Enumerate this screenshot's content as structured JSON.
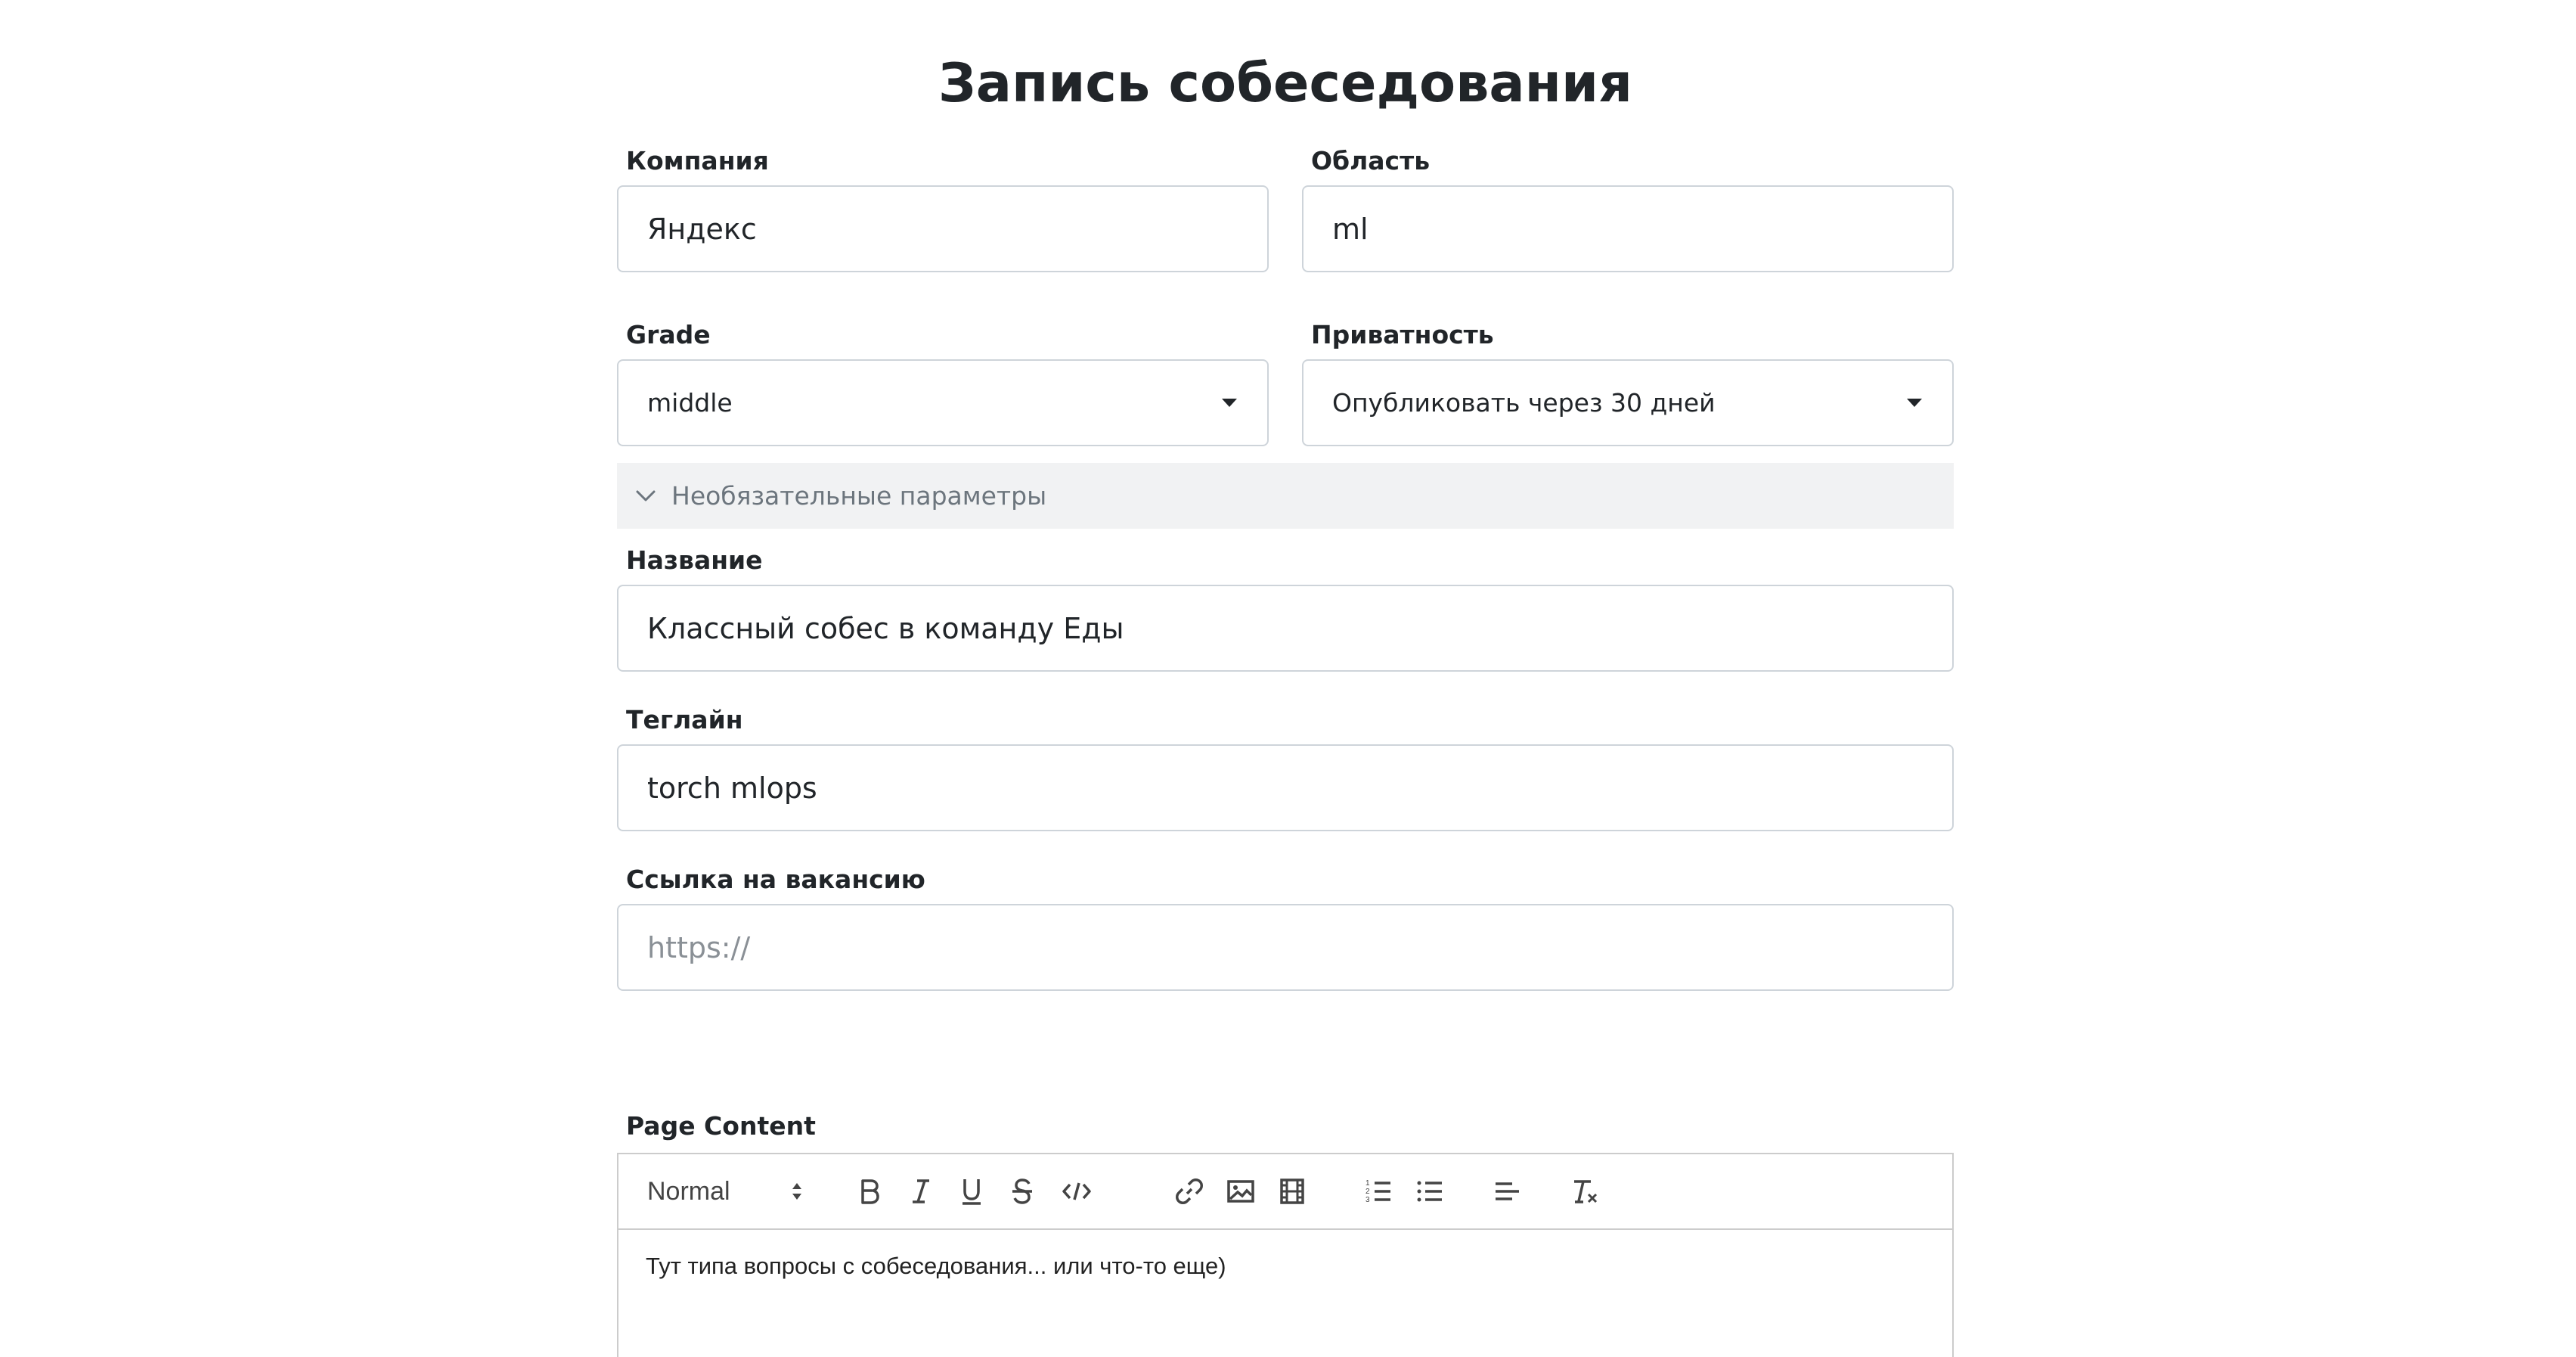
{
  "title": "Запись собеседования",
  "company": {
    "label": "Компания",
    "value": "Яндекс"
  },
  "area": {
    "label": "Область",
    "value": "ml"
  },
  "grade": {
    "label": "Grade",
    "value": "middle"
  },
  "privacy": {
    "label": "Приватность",
    "value": "Опубликовать через 30 дней"
  },
  "optional_section": {
    "label": "Необязательные параметры",
    "expanded": true
  },
  "name": {
    "label": "Название",
    "value": "Классный собес в команду Еды"
  },
  "tagline": {
    "label": "Теглайн",
    "value": "torch mlops"
  },
  "vacancy_link": {
    "label": "Ссылка на вакансию",
    "value": "",
    "placeholder": "https://"
  },
  "content": {
    "label": "Page Content",
    "format": "Normal",
    "text": "Тут типа вопросы с собеседования... или что-то еще)",
    "toolbar_icons": [
      "bold-icon",
      "italic-icon",
      "underline-icon",
      "strikethrough-icon",
      "code-block-icon",
      "link-icon",
      "image-icon",
      "video-icon",
      "ordered-list-icon",
      "bullet-list-icon",
      "align-icon",
      "clear-format-icon"
    ]
  }
}
